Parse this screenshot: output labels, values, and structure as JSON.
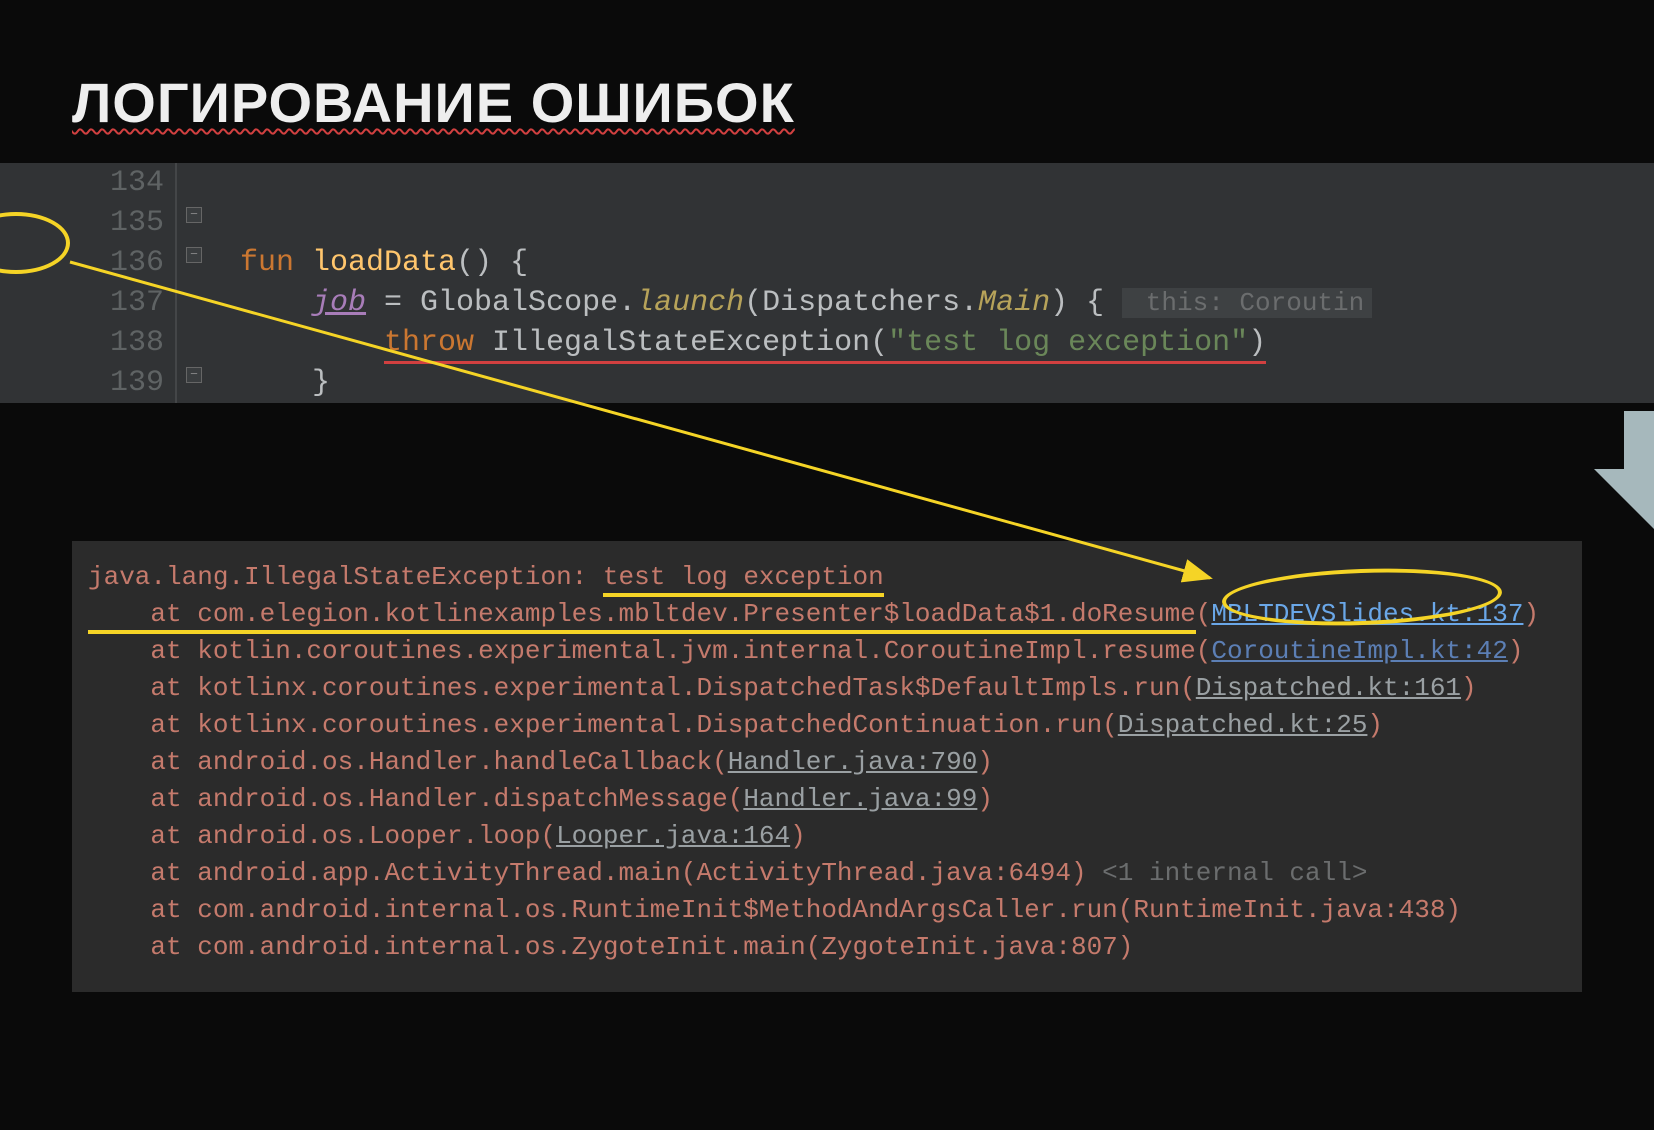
{
  "title": "ЛОГИРОВАНИЕ ОШИБОК",
  "editor": {
    "lines": [
      "134",
      "135",
      "136",
      "137",
      "138",
      "139"
    ],
    "kw_fun": "fun",
    "fn_name": "loadData",
    "paren_open": "() {",
    "prop_job": "job",
    "assign": " = GlobalScope.",
    "launch": "launch",
    "launch_args": "(Dispatchers.",
    "main": "Main",
    "launch_close": ") {",
    "hint": " this: Coroutin",
    "kw_throw": "throw",
    "exc_call": " IllegalStateException(",
    "str_lit": "\"test log exception\"",
    "close_paren": ")",
    "brace1": "}",
    "brace2": "}"
  },
  "stack": {
    "l0a": "java.lang.IllegalStateException: ",
    "l0b": "test log exception",
    "l1a": "    at com.elegion.kotlinexamples.mbltdev.Presenter$loadData$1.doResume",
    "l1b": "(",
    "l1c": "MBLTDEVSlides.kt:137",
    "l1d": ")",
    "l2": "    at kotlin.coroutines.experimental.jvm.internal.CoroutineImpl.resume(",
    "l2b": "CoroutineImpl.kt:42",
    "l2c": ")",
    "l3": "    at kotlinx.coroutines.experimental.DispatchedTask$DefaultImpls.run(",
    "l3b": "Dispatched.kt:161",
    "l3c": ")",
    "l4": "    at kotlinx.coroutines.experimental.DispatchedContinuation.run(",
    "l4b": "Dispatched.kt:25",
    "l4c": ")",
    "l5": "    at android.os.Handler.handleCallback(",
    "l5b": "Handler.java:790",
    "l5c": ")",
    "l6": "    at android.os.Handler.dispatchMessage(",
    "l6b": "Handler.java:99",
    "l6c": ")",
    "l7": "    at android.os.Looper.loop(",
    "l7b": "Looper.java:164",
    "l7c": ")",
    "l8": "    at android.app.ActivityThread.main(ActivityThread.java:6494) ",
    "l8b": "<1 internal call>",
    "l9": "    at com.android.internal.os.RuntimeInit$MethodAndArgsCaller.run(RuntimeInit.java:438)",
    "l10": "    at com.android.internal.os.ZygoteInit.main(ZygoteInit.java:807)"
  }
}
